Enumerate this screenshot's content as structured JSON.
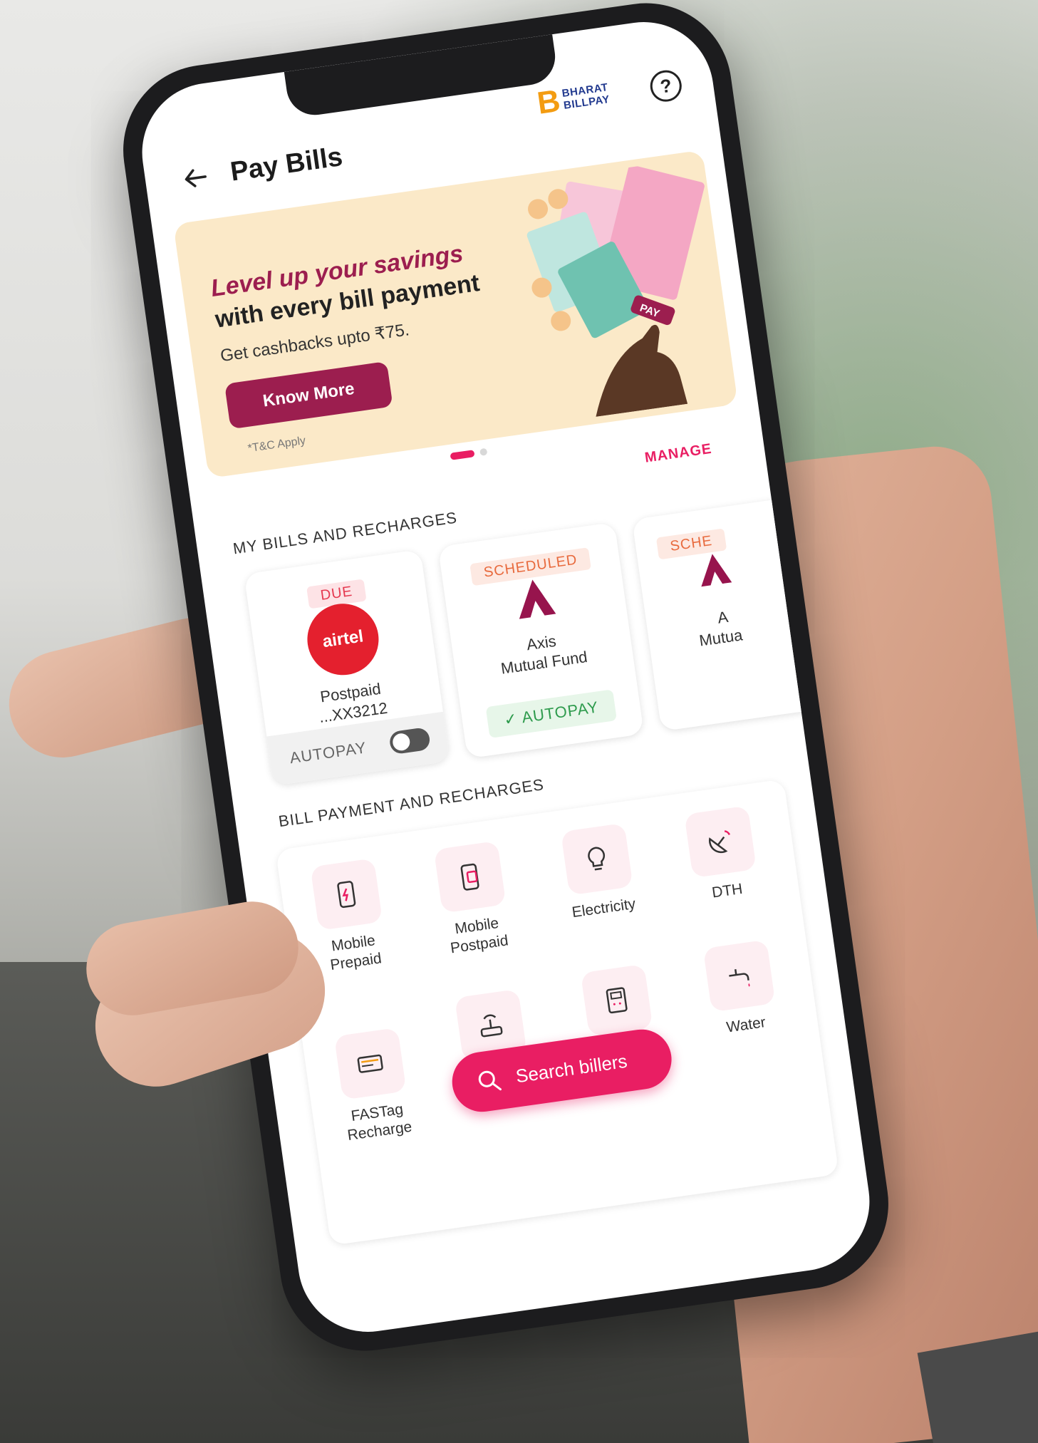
{
  "header": {
    "title": "Pay Bills",
    "logo_text_line1": "BHARAT",
    "logo_text_line2": "BILLPAY",
    "logo_letter": "B",
    "help_symbol": "?"
  },
  "banner": {
    "title": "Level up your savings",
    "subtitle": "with every bill payment",
    "note": "Get cashbacks upto ₹75.",
    "cta_label": "Know More",
    "tnc": "*T&C Apply",
    "art_label": "PAY",
    "page_indicator": {
      "total": 2,
      "active": 1
    }
  },
  "my_bills": {
    "section_title": "MY BILLS AND RECHARGES",
    "manage_label": "MANAGE",
    "cards": [
      {
        "badge": "DUE",
        "logo_text": "airtel",
        "name_line1": "Postpaid",
        "name_line2": "...XX3212",
        "autopay_label": "AUTOPAY",
        "autopay_enabled": false
      },
      {
        "badge": "SCHEDULED",
        "name_line1": "Axis",
        "name_line2": "Mutual Fund",
        "autopay_label": "AUTOPAY",
        "autopay_enabled": true,
        "autopay_check": "✓"
      },
      {
        "badge": "SCHE",
        "name_line1": "A",
        "name_line2": "Mutua"
      }
    ]
  },
  "bill_payment": {
    "section_title": "BILL PAYMENT AND RECHARGES",
    "tiles": [
      {
        "label_line1": "Mobile",
        "label_line2": "Prepaid",
        "icon": "mobile-prepaid-icon"
      },
      {
        "label_line1": "Mobile",
        "label_line2": "Postpaid",
        "icon": "mobile-postpaid-icon"
      },
      {
        "label_line1": "Electricity",
        "label_line2": "",
        "icon": "bulb-icon"
      },
      {
        "label_line1": "DTH",
        "label_line2": "",
        "icon": "satellite-dish-icon"
      },
      {
        "label_line1": "FASTag",
        "label_line2": "Recharge",
        "icon": "fastag-icon"
      },
      {
        "label_line1": "",
        "label_line2": "",
        "icon": "broadband-router-icon"
      },
      {
        "label_line1": "",
        "label_line2": "",
        "icon": "landline-icon"
      },
      {
        "label_line1": "Water",
        "label_line2": "",
        "icon": "water-tap-icon"
      }
    ]
  },
  "search": {
    "label": "Search billers"
  },
  "colors": {
    "brand_pink": "#e91e63",
    "brand_maroon": "#9c1e4f",
    "banner_bg": "#fbe9c8",
    "due_red": "#e53950",
    "scheduled_orange": "#e86a3d",
    "autopay_green": "#2e9b4d"
  }
}
